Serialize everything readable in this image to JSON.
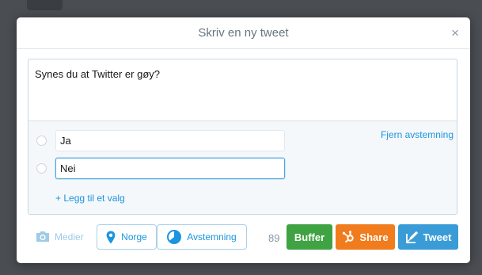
{
  "dialog": {
    "title": "Skriv en ny tweet",
    "close_label": "×"
  },
  "tweet": {
    "text": "Synes du at Twitter er gøy?"
  },
  "poll": {
    "remove_label": "Fjern avstemning",
    "choices": [
      {
        "value": "Ja"
      },
      {
        "value": "Nei"
      }
    ],
    "add_choice_label": "+ Legg til et valg"
  },
  "toolbar": {
    "media_label": "Medier",
    "location_label": "Norge",
    "poll_label": "Avstemning",
    "char_count": "89",
    "buffer_label": "Buffer",
    "share_label": "Share",
    "tweet_label": "Tweet"
  },
  "colors": {
    "buffer": "#3fa343",
    "share": "#f07c1d",
    "tweet": "#3a9cd6",
    "link": "#1b95e0"
  },
  "icons": {
    "media": "camera-icon",
    "location": "location-pin-icon",
    "poll": "pie-chart-icon",
    "share": "hubspot-icon",
    "tweet": "compose-icon",
    "close": "close-icon"
  }
}
